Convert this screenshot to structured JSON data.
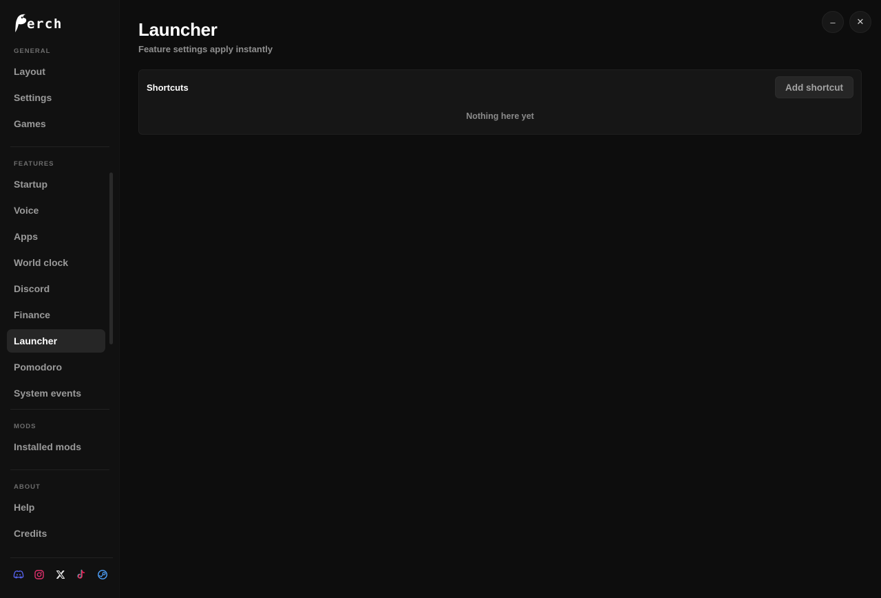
{
  "app": {
    "logo_text": "erch"
  },
  "sidebar": {
    "sections": [
      {
        "label": "GENERAL",
        "items": [
          {
            "label": "Layout"
          },
          {
            "label": "Settings"
          },
          {
            "label": "Games"
          }
        ]
      },
      {
        "label": "FEATURES",
        "items": [
          {
            "label": "Startup"
          },
          {
            "label": "Voice"
          },
          {
            "label": "Apps"
          },
          {
            "label": "World clock"
          },
          {
            "label": "Discord"
          },
          {
            "label": "Finance"
          },
          {
            "label": "Launcher",
            "active": true
          },
          {
            "label": "Pomodoro"
          },
          {
            "label": "System events"
          }
        ]
      },
      {
        "label": "MODS",
        "items": [
          {
            "label": "Installed mods"
          }
        ]
      },
      {
        "label": "ABOUT",
        "items": [
          {
            "label": "Help"
          },
          {
            "label": "Credits"
          }
        ]
      }
    ],
    "social": [
      {
        "icon": "discord-icon",
        "color": "#5865f2"
      },
      {
        "icon": "instagram-icon",
        "color": "#e1306c"
      },
      {
        "icon": "x-icon",
        "color": "#e6e6e6"
      },
      {
        "icon": "tiktok-icon",
        "color": "#ee1d52"
      },
      {
        "icon": "steam-icon",
        "color": "#4fa3ff"
      }
    ]
  },
  "window": {
    "minimize_label": "–",
    "close_label": "✕"
  },
  "main": {
    "title": "Launcher",
    "subtitle": "Feature settings apply instantly",
    "card": {
      "title": "Shortcuts",
      "add_button": "Add shortcut",
      "empty_text": "Nothing here yet"
    }
  }
}
